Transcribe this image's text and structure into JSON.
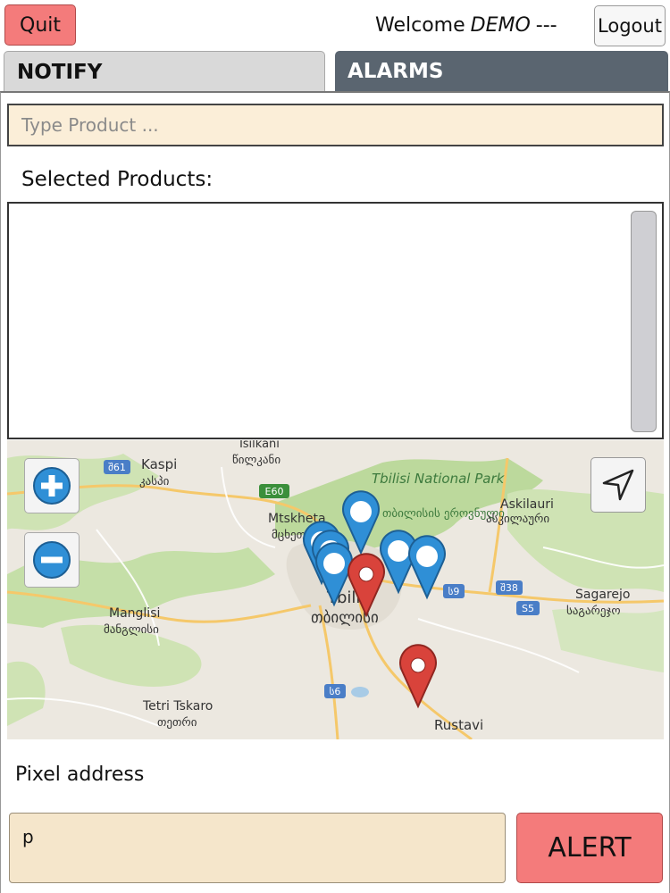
{
  "header": {
    "quit_label": "Quit",
    "welcome_prefix": "Welcome",
    "user_name": "DEMO",
    "welcome_suffix": "---",
    "logout_label": "Logout"
  },
  "tabs": [
    {
      "label": "NOTIFY",
      "active": true
    },
    {
      "label": "ALARMS",
      "active": false
    }
  ],
  "product_search": {
    "placeholder": "Type Product ...",
    "value": ""
  },
  "selected_products": {
    "title": "Selected Products:",
    "items": []
  },
  "map": {
    "places": {
      "tsilkani": "Tsilkani",
      "tsilkani_ka": "წილკანი",
      "kaspi": "Kaspi",
      "kaspi_ka": "კასპი",
      "national_park": "Tbilisi National Park",
      "national_park_ka": "თბილისის ეროვნული",
      "mtskheta": "Mtskheta",
      "mtskheta_ka": "მცხეთა",
      "askilauri": "Askilauri",
      "askilauri_ka": "ასკილაური",
      "tbilisi": "Tbilisi",
      "tbilisi_ka": "თბილისი",
      "sagarejo": "Sagarejo",
      "sagarejo_ka": "საგარეჯო",
      "manglisi": "Manglisi",
      "manglisi_ka": "მანგლისი",
      "tetri_tskaro": "Tetri Tskaro",
      "tetri_tskaro_ka": "თეთრი",
      "rustavi": "Rustavi"
    },
    "road_shields": [
      "შ61",
      "E60",
      "ს9",
      "შ38",
      "S5",
      "ს6"
    ],
    "markers": {
      "blue": 6,
      "red": 2
    },
    "colors": {
      "blue_marker": "#2f8fd6",
      "red_marker": "#d9433b"
    },
    "icons": {
      "zoom_in": "plus-icon",
      "zoom_out": "minus-icon",
      "locate": "navigation-arrow-icon"
    }
  },
  "address": {
    "label": "Pixel address",
    "value": "p"
  },
  "alert_label": "ALERT",
  "colors": {
    "danger": "#f47b7b",
    "input_bg": "#fbeed8",
    "tab_inactive": "#5a6570"
  }
}
